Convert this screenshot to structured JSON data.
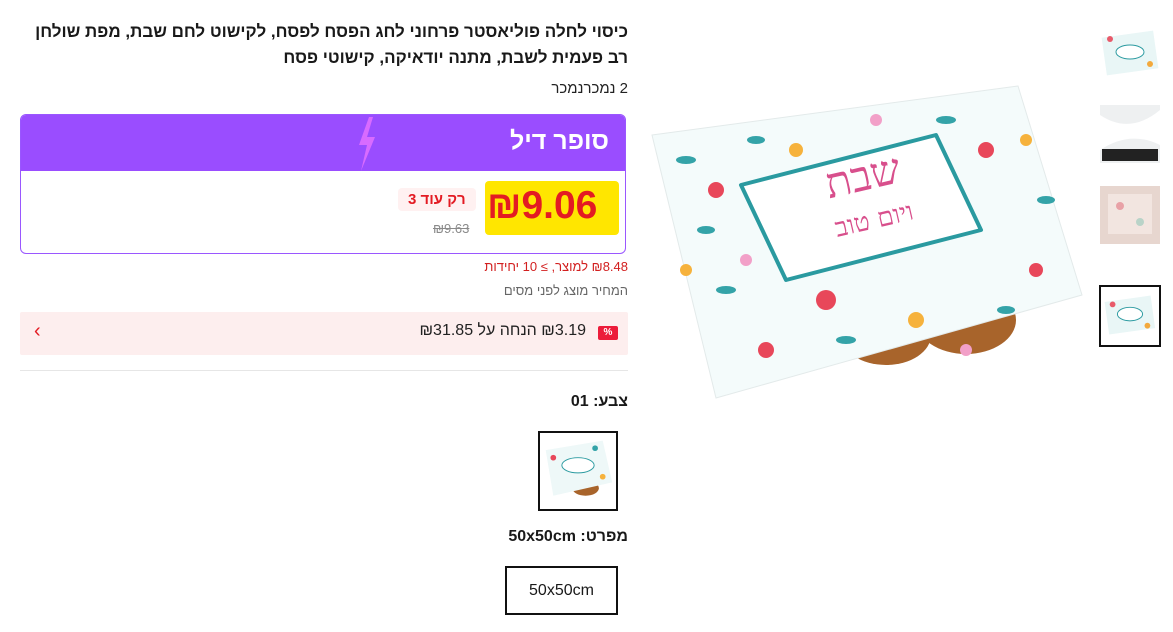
{
  "product": {
    "title": "כיסוי לחלה פוליאסטר פרחוני לחג הפסח לפסח, לקישוט לחם שבת, מפת שולחן רב פעמית לשבת, מתנה יודאיקה, קישוטי פסח",
    "sold": "2 נמכרנמכר",
    "image_text_line1": "שבת",
    "image_text_line2": "ויום טוב"
  },
  "deal": {
    "title": "סופר דיל",
    "price": "₪9.06",
    "only_left": "רק עוד 3",
    "old_price": "₪9.63"
  },
  "bulk_price": "₪8.48 למוצר, ≥ 10 יחידות",
  "tax_note": "המחיר מוצג לפני מסים",
  "coupon": {
    "icon": "%",
    "text": "₪3.19 הנחה על ₪31.85",
    "arrow": "‹"
  },
  "color": {
    "label": "צבע: 01"
  },
  "size": {
    "label": "מפרט: 50x50cm",
    "option": "50x50cm"
  },
  "colors": {
    "deal_purple": "#9a4dff",
    "price_red": "#e31b23",
    "highlight_yellow": "#ffe600",
    "coupon_bg": "#fdeeee"
  },
  "icons": [
    "lightning-bolt-icon",
    "coupon-percent-icon",
    "chevron-left-icon"
  ]
}
